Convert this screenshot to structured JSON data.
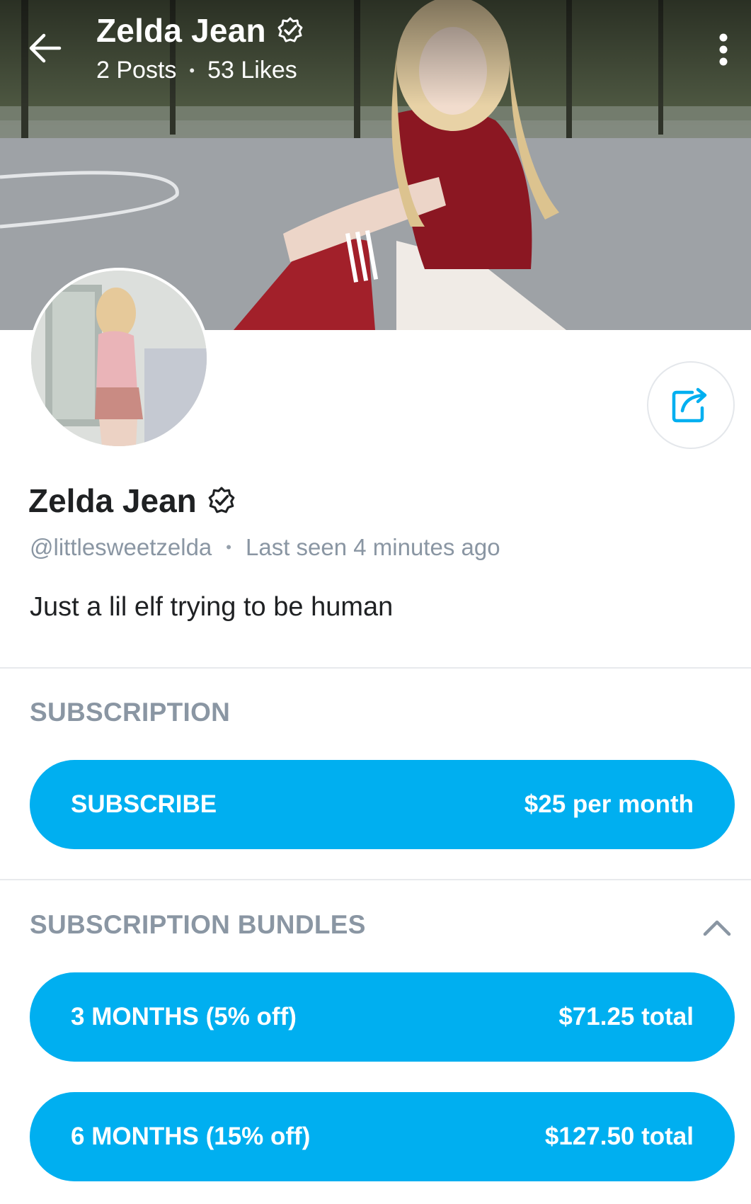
{
  "header": {
    "name": "Zelda Jean",
    "posts": "2 Posts",
    "likes": "53 Likes"
  },
  "profile": {
    "name": "Zelda Jean",
    "handle": "@littlesweetzelda",
    "last_seen": "Last seen 4 minutes ago",
    "bio": "Just a lil elf trying to be human"
  },
  "subscription": {
    "section_title": "SUBSCRIPTION",
    "button_label": "SUBSCRIBE",
    "price": "$25 per month"
  },
  "bundles": {
    "section_title": "SUBSCRIPTION BUNDLES",
    "items": [
      {
        "label": "3 MONTHS (5% off)",
        "price": "$71.25 total"
      },
      {
        "label": "6 MONTHS (15% off)",
        "price": "$127.50 total"
      }
    ]
  },
  "colors": {
    "accent": "#00aff0",
    "muted_text": "#8a96a3",
    "primary_text": "#1f2123"
  },
  "icons": {
    "back": "arrow-left-icon",
    "verified": "verified-badge-icon",
    "more": "more-vertical-icon",
    "share": "share-icon",
    "collapse": "chevron-up-icon"
  }
}
